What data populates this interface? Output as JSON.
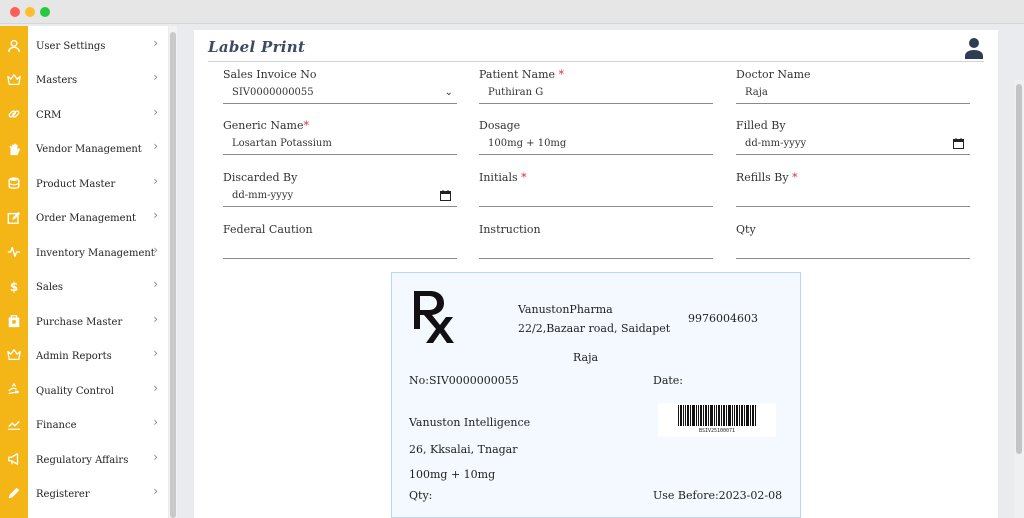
{
  "window": {
    "controls": [
      "close",
      "minimize",
      "maximize"
    ]
  },
  "sidebar": {
    "items": [
      {
        "label": "User Settings",
        "icon": "user-icon"
      },
      {
        "label": "Masters",
        "icon": "crown-icon"
      },
      {
        "label": "CRM",
        "icon": "link-icon"
      },
      {
        "label": "Vendor Management",
        "icon": "hand-icon"
      },
      {
        "label": "Product Master",
        "icon": "database-icon"
      },
      {
        "label": "Order Management",
        "icon": "edit-icon"
      },
      {
        "label": "Inventory Management",
        "icon": "pulse-icon"
      },
      {
        "label": "Sales",
        "icon": "dollar-icon"
      },
      {
        "label": "Purchase Master",
        "icon": "bag-icon"
      },
      {
        "label": "Admin Reports",
        "icon": "crown-icon"
      },
      {
        "label": "Quality Control",
        "icon": "hand-pointer-icon"
      },
      {
        "label": "Finance",
        "icon": "chart-icon"
      },
      {
        "label": "Regulatory Affairs",
        "icon": "megaphone-icon"
      },
      {
        "label": "Registerer",
        "icon": "pencil-icon"
      }
    ]
  },
  "page": {
    "title": "Label Print"
  },
  "form": {
    "sales_invoice": {
      "label": "Sales Invoice No",
      "value": "SIV0000000055"
    },
    "patient_name": {
      "label": "Patient Name",
      "value": "Puthiran G"
    },
    "doctor_name": {
      "label": "Doctor Name",
      "value": "Raja"
    },
    "generic_name": {
      "label": "Generic Name",
      "value": "Losartan Potassium"
    },
    "dosage": {
      "label": "Dosage",
      "value": "100mg + 10mg"
    },
    "filled_by": {
      "label": "Filled By",
      "value": "dd-mm-yyyy"
    },
    "discarded_by": {
      "label": "Discarded By",
      "value": "dd-mm-yyyy"
    },
    "initials": {
      "label": "Initials",
      "value": ""
    },
    "refills_by": {
      "label": "Refills By",
      "value": ""
    },
    "federal_caution": {
      "label": "Federal Caution",
      "value": ""
    },
    "instruction": {
      "label": "Instruction",
      "value": ""
    },
    "qty": {
      "label": "Qty",
      "value": ""
    },
    "required_mark": "*"
  },
  "label_card": {
    "rx_symbol": "Rx",
    "company": "VanustonPharma",
    "address": "22/2,Bazaar road, Saidapet",
    "phone": "9976004603",
    "doctor": "Raja",
    "invoice": "No:SIV0000000055",
    "date_label": "Date:",
    "org": "Vanuston Intelligence",
    "org_address": "26, Kksalai, Tnagar",
    "dosage": "100mg + 10mg",
    "qty_label": "Qty:",
    "use_before": "Use Before:2023-02-08",
    "barcode_text": "BSIV25100071"
  },
  "colors": {
    "accent": "#f4b517",
    "title": "#3c4a63",
    "required": "#d32f2f",
    "card_bg": "#f3f9fe"
  }
}
